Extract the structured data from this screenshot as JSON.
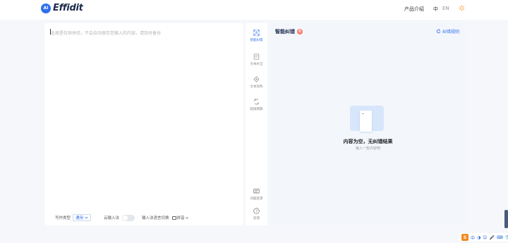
{
  "header": {
    "logo_badge": "AI",
    "logo_text": "Effidit",
    "nav_product": "产品介绍",
    "lang_zh": "中",
    "lang_en": "EN"
  },
  "editor": {
    "placeholder": "此原是仅供体验，不会自动保存您输入的内容，请及时备份",
    "footer": {
      "type_label": "写作类型",
      "type_value": "通用",
      "cloud_ime_label": "云输入法",
      "ime_switch_label": "输入法语言切换",
      "ime_value": "拼音"
    }
  },
  "tools": [
    {
      "label": "智能纠错",
      "icon": "error-check-icon",
      "active": true
    },
    {
      "label": "文本补全",
      "icon": "text-complete-icon",
      "active": false
    },
    {
      "label": "文本润色",
      "icon": "polish-icon",
      "active": false
    },
    {
      "label": "超级网典",
      "icon": "dictionary-icon",
      "active": false
    },
    {
      "label": "问题反馈",
      "icon": "feedback-icon",
      "active": false
    },
    {
      "label": "反馈",
      "icon": "help-icon",
      "active": false
    }
  ],
  "result": {
    "title": "智能纠错",
    "count": "0",
    "rules_button": "纠错规则",
    "empty_title": "内容为空，无纠错结果",
    "empty_subtitle": "输入一些内容吧"
  },
  "ime_bar": {
    "logo": "S",
    "items": [
      "中",
      "◑",
      "☺",
      "🎤",
      "⌨",
      "👕",
      "▦"
    ]
  },
  "colors": {
    "accent": "#2f6fed",
    "badge": "#ff7a6b",
    "panel_bg": "#f3f7fc",
    "ime_orange": "#f08a24"
  }
}
